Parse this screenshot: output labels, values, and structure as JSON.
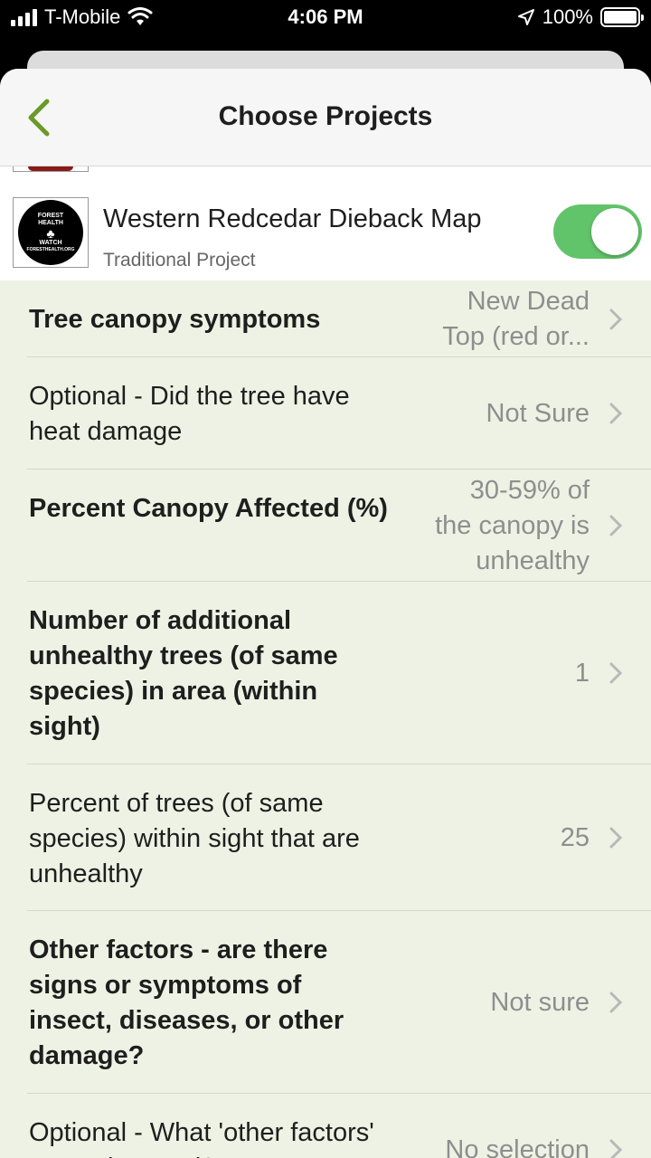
{
  "status_bar": {
    "carrier": "T-Mobile",
    "time": "4:06 PM",
    "battery": "100%",
    "icons": [
      "signal-icon",
      "wifi-icon",
      "location-arrow-icon",
      "battery-icon"
    ]
  },
  "nav": {
    "title": "Choose Projects",
    "back_icon": "chevron-left-icon",
    "accent_color": "#6a9a2a"
  },
  "project": {
    "logo_text": [
      "FOREST",
      "HEALTH",
      "WATCH",
      "FORESTHEALTH.ORG"
    ],
    "title": "Western Redcedar Dieback Map",
    "subtitle": "Traditional Project",
    "enabled": true,
    "toggle_color": "#62c46a"
  },
  "fields": [
    {
      "label": "Tree canopy symptoms",
      "value": "New Dead Top (red or...",
      "value_lines": [
        "New Dead",
        "Top (red or..."
      ],
      "required": true
    },
    {
      "label": "Optional - Did the tree have heat damage",
      "value": "Not Sure",
      "required": false
    },
    {
      "label": "Percent Canopy Affected (%)",
      "value": "30-59% of the canopy is unhealthy",
      "value_lines": [
        "30-59% of",
        "the canopy is",
        "unhealthy"
      ],
      "required": true
    },
    {
      "label": "Number of additional unhealthy trees (of same species) in area (within sight)",
      "value": "1",
      "required": true
    },
    {
      "label": "Percent of trees (of same species) within sight that are unhealthy",
      "value": "25",
      "required": false
    },
    {
      "label": "Other factors - are there signs or symptoms of insect, diseases, or other damage?",
      "value": "Not sure",
      "required": true
    },
    {
      "label": "Optional - What 'other factors' were observed?",
      "value": "No selection",
      "required": false
    }
  ]
}
